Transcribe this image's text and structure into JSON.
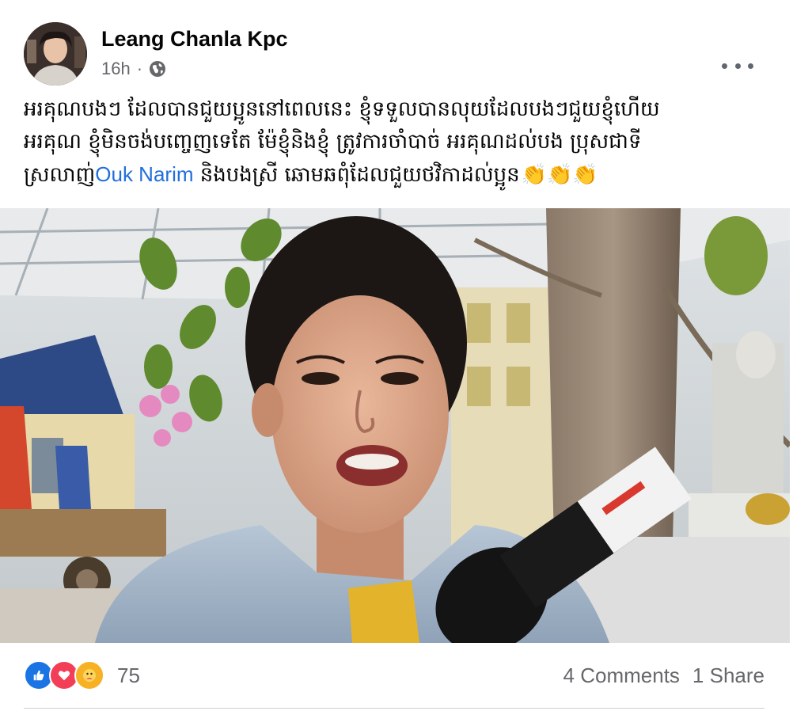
{
  "post": {
    "author": "Leang Chanla Kpc",
    "time": "16h",
    "separator": "·",
    "audience_icon": "globe-icon",
    "text_line_1": "អរគុណបងៗ ដែលបានជួយប្អូននៅពេលនេះ ខ្ញុំទទួលបានលុយដែលបងៗជួយខ្ញុំហើយ",
    "text_line_2": "អរគុណ ខ្ញុំមិនចង់បញ្ចេញទេតែ ម៉ែខ្ញុំនិងខ្ញុំ ត្រូវការចាំបាច់ អរគុណដល់បង ប្រុសជាទី",
    "text_line_3_before": "ស្រលាញ់",
    "mention": "Ouk Narim",
    "text_line_3_after": " និងបងស្រី ឆោមឆពុំដែលជួយថវិកាដល់ប្អូន",
    "claps": "👏👏👏"
  },
  "reactions": {
    "icons": [
      "like-icon",
      "love-icon",
      "care-icon"
    ],
    "count": "75"
  },
  "stats": {
    "comments": "4 Comments",
    "shares": "1 Share"
  },
  "colors": {
    "link": "#216fdb",
    "secondary_text": "#65676b",
    "like": "#1b74e4",
    "love": "#f33e58",
    "care": "#f7b125"
  }
}
